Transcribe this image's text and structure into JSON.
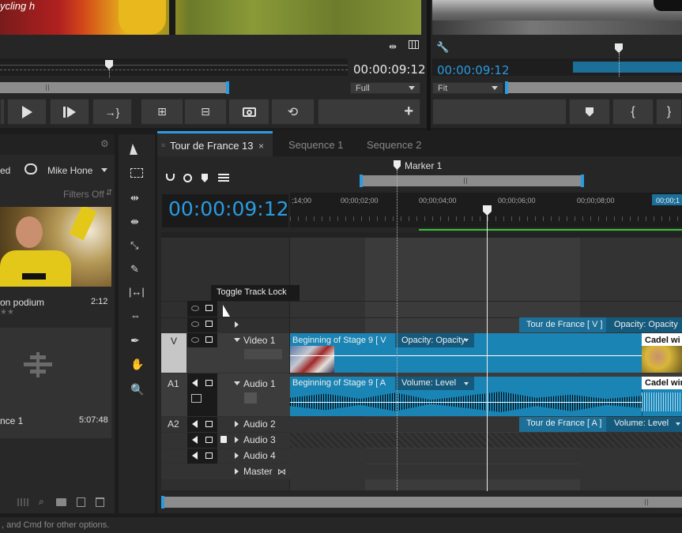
{
  "source_monitor": {
    "timecode": "00:00:09:12",
    "zoom": "Full",
    "overlay_text": "ycling h"
  },
  "program_monitor": {
    "timecode": "00:00:09:12",
    "zoom": "Fit"
  },
  "project": {
    "user": "Mike Hone",
    "shared_label": "ed",
    "filters_label": "Filters Off",
    "clip1": {
      "name": "on podium",
      "duration": "2:12"
    },
    "clip2": {
      "name": "nce 1",
      "duration": "5:07:48"
    }
  },
  "timeline": {
    "tabs": [
      {
        "label": "Tour de France 13",
        "active": true
      },
      {
        "label": "Sequence 1",
        "active": false
      },
      {
        "label": "Sequence  2",
        "active": false
      }
    ],
    "timecode": "00:00:09:12",
    "marker_label": "Marker 1",
    "ruler_ticks": [
      ";14;00",
      "00;00;02;00",
      "00;00;04;00",
      "00;00;06;00",
      "00;00;08;00",
      "00;00;1"
    ],
    "tooltip": "Toggle Track Lock",
    "tracks": {
      "v_label": "V",
      "a1_label": "A1",
      "a2_label": "A2",
      "video1": "Video 1",
      "audio1": "Audio 1",
      "audio2": "Audio 2",
      "audio3": "Audio 3",
      "audio4": "Audio 4",
      "master": "Master"
    },
    "clips": {
      "tdf_v": "Tour de France [ V ]",
      "tdf_v_fx": "Opacity: Opacity",
      "stage9_v": "Beginning of Stage 9 [ V",
      "stage9_v_fx": "Opacity: Opacity",
      "cadel_v": "Cadel wi",
      "stage9_a": "Beginning of Stage 9 [ A",
      "stage9_a_fx": "Volume: Level",
      "cadel_a": "Cadel win",
      "tdf_a": "Tour de France [ A ]",
      "tdf_a_fx": "Volume: Level"
    }
  },
  "status_bar": {
    "text": ", and Cmd for other options."
  },
  "colors": {
    "accent": "#2a9be0",
    "clip_blue": "#1a84b4",
    "clip_dark_blue": "#1b6f99"
  }
}
